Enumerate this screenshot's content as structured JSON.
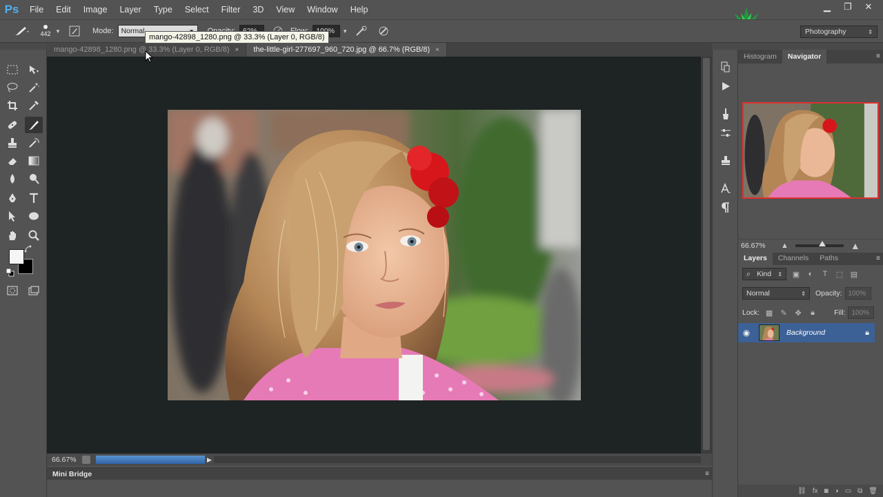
{
  "app": {
    "logo": "Ps"
  },
  "menu": [
    "File",
    "Edit",
    "Image",
    "Layer",
    "Type",
    "Select",
    "Filter",
    "3D",
    "View",
    "Window",
    "Help"
  ],
  "window_controls": {
    "minimize": "▁",
    "maximize": "❐",
    "close": "✕"
  },
  "options": {
    "brush_size": "442",
    "mode_label": "Mode:",
    "mode_value": "Normal",
    "opacity_label": "Opacity:",
    "opacity_value": "62%",
    "flow_label": "Flow:",
    "flow_value": "100%"
  },
  "workspace": "Photography",
  "tooltip": "mango-42898_1280.png @ 33.3% (Layer 0, RGB/8)",
  "documents": [
    {
      "title": "mango-42898_1280.png @ 33.3% (Layer 0, RGB/8)",
      "active": false
    },
    {
      "title": "the-little-girl-277697_960_720.jpg @ 66.7% (RGB/8)",
      "active": true
    }
  ],
  "close_glyph": "×",
  "status": {
    "zoom": "66.67%"
  },
  "mini_bridge": {
    "label": "Mini Bridge"
  },
  "navigator": {
    "tabs": [
      "Histogram",
      "Navigator"
    ],
    "active": "Navigator",
    "zoom": "66.67%"
  },
  "layers_panel": {
    "tabs": [
      "Layers",
      "Channels",
      "Paths"
    ],
    "active": "Layers",
    "filter_label": "Kind",
    "blend_mode": "Normal",
    "opacity_label": "Opacity:",
    "opacity_value": "100%",
    "lock_label": "Lock:",
    "fill_label": "Fill:",
    "fill_value": "100%",
    "layers": [
      {
        "name": "Background",
        "visible": true,
        "locked": true
      }
    ]
  },
  "colors": {
    "accent_selection": "#3b6196",
    "navigator_frame": "#e0302e",
    "canvas_bg": "#1e2323"
  }
}
